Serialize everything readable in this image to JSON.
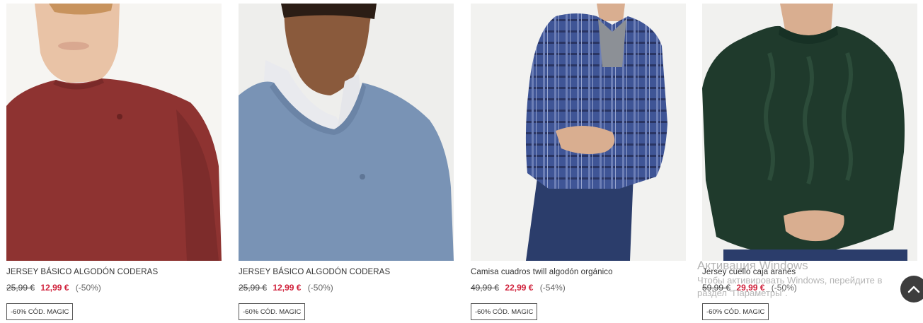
{
  "products": [
    {
      "name": "JERSEY BÁSICO ALGODÓN CODERAS",
      "old_price": "25,99 €",
      "new_price": "12,99 €",
      "discount": "(-50%)",
      "badge": "-60% CÓD. MAGIC",
      "image": "model in red crew-neck jersey"
    },
    {
      "name": "JERSEY BÁSICO ALGODÓN CODERAS",
      "old_price": "25,99 €",
      "new_price": "12,99 €",
      "discount": "(-50%)",
      "badge": "-60% CÓD. MAGIC",
      "image": "model in blue crew-neck jersey over white shirt"
    },
    {
      "name": "Camisa cuadros twill algodón orgánico",
      "old_price": "49,99 €",
      "new_price": "22,99 €",
      "discount": "(-54%)",
      "badge": "-60% CÓD. MAGIC",
      "image": "model in blue plaid shirt and jeans"
    },
    {
      "name": "Jersey cuello caja aranés",
      "old_price": "59,99 €",
      "new_price": "29,99 €",
      "discount": "(-50%)",
      "badge": "-60% CÓD. MAGIC",
      "image": "model in dark green cable-knit jersey"
    }
  ],
  "watermark": {
    "title": "Активация Windows",
    "text": "Чтобы активировать Windows, перейдите в раздел \"Параметры\"."
  },
  "scroll_top": {
    "icon": "chevron-up-icon"
  },
  "colors": {
    "sale_price": "#d0203a",
    "scroll_button": "#3d3d3d"
  }
}
